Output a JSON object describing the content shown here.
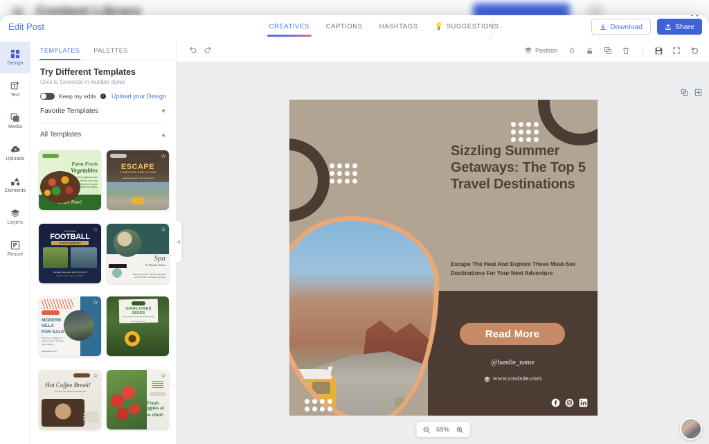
{
  "background_app": {
    "title": "Content Library",
    "menu_icon": "hamburger-icon",
    "primary_button_label": "",
    "avatar": "user-avatar"
  },
  "modal": {
    "close_icon": "close-icon",
    "edit_post_label": "Edit Post",
    "tabs": [
      {
        "label": "CREATIVES",
        "active": true,
        "icon": ""
      },
      {
        "label": "CAPTIONS",
        "active": false,
        "icon": ""
      },
      {
        "label": "HASHTAGS",
        "active": false,
        "icon": ""
      },
      {
        "label": "SUGGESTIONS",
        "active": false,
        "icon": "lightbulb-icon"
      }
    ],
    "actions": {
      "download_label": "Download",
      "download_icon": "download-icon",
      "share_label": "Share",
      "share_icon": "share-icon"
    }
  },
  "rail": {
    "items": [
      {
        "label": "Design",
        "icon": "design-grid-icon",
        "active": true
      },
      {
        "label": "Text",
        "icon": "text-add-icon",
        "active": false
      },
      {
        "label": "Media",
        "icon": "media-image-icon",
        "active": false
      },
      {
        "label": "Uploads",
        "icon": "upload-cloud-icon",
        "active": false
      },
      {
        "label": "Elements",
        "icon": "elements-shapes-icon",
        "active": false
      },
      {
        "label": "Layers",
        "icon": "layers-stack-icon",
        "active": false
      },
      {
        "label": "Resize",
        "icon": "resize-icon",
        "active": false
      }
    ]
  },
  "panel": {
    "tabs": [
      {
        "label": "TEMPLATES",
        "active": true
      },
      {
        "label": "PALETTES",
        "active": false
      }
    ],
    "heading": "Try Different Templates",
    "subheading": "Click to Generate in multiple styles",
    "toggle_label": "Keep my edits",
    "toggle_info_icon": "info-icon",
    "toggle_state": "off",
    "upload_link": "Upload your Design",
    "sections": [
      {
        "label": "Favorite Templates",
        "expanded": false,
        "chevron": "chevron-down-icon"
      },
      {
        "label": "All Templates",
        "expanded": true,
        "chevron": "chevron-up-icon"
      }
    ],
    "collapse_handle_icon": "chevron-left-icon",
    "templates": [
      {
        "name": "Farm Fresh Vegetables",
        "title_line1": "Farm Fresh",
        "title_line2": "Vegetables",
        "cta": "Order Now!",
        "favorited": false
      },
      {
        "name": "Escape Discover New Places",
        "title_line1": "ESCAPE",
        "title_line2": "& DISCOVER NEW PLACES",
        "cta": "",
        "favorited": true
      },
      {
        "name": "Football Tournament",
        "title_line1": "FOOTBALL",
        "title_line2": "TOURNAMENT",
        "cta": "",
        "favorited": true
      },
      {
        "name": "Spa Beauty Salon",
        "title_line1": "Spa",
        "title_line2": "& Beauty Salon",
        "cta": "",
        "favorited": true
      },
      {
        "name": "Modern Villa For Sale",
        "title_line1": "MODERN VILLA",
        "title_line2": "FOR SALE",
        "cta": "",
        "favorited": true
      },
      {
        "name": "Sunflower Seeds",
        "title_line1": "SUNFLOWER",
        "title_line2": "SEEDS",
        "cta": "",
        "favorited": false
      },
      {
        "name": "Hot Coffee Break",
        "title_line1": "Hot Coffee Break!",
        "title_line2": "",
        "cta": "",
        "favorited": true
      },
      {
        "name": "Fresh Veggies at one click",
        "title_line1": "Fresh Veggies at",
        "title_line2": "one click!",
        "cta": "",
        "favorited": true
      }
    ]
  },
  "canvas_toolbar": {
    "undo_icon": "undo-icon",
    "redo_icon": "redo-icon",
    "position_label": "Position",
    "position_icon": "layers-icon",
    "transparency_icon": "droplet-icon",
    "lock_icon": "unlock-icon",
    "duplicate_icon": "duplicate-icon",
    "delete_icon": "trash-icon",
    "save_icon": "save-floppy-icon",
    "fullscreen_icon": "fullscreen-icon",
    "reset_icon": "reset-icon"
  },
  "canvas_page_icons": {
    "duplicate_page_icon": "duplicate-page-icon",
    "add_page_icon": "add-page-icon"
  },
  "zoom_control": {
    "zoom_out_icon": "zoom-out-icon",
    "value": "69%",
    "zoom_in_icon": "zoom-in-icon"
  },
  "poster": {
    "headline": "Sizzling Summer Getaways: The Top 5 Travel Destinations",
    "subline": "Escape The Heat And Explore These Must-See Destinations For Your Next Adventure",
    "cta_label": "Read More",
    "handle": "@handle_name",
    "website": "www.coolsite.com",
    "website_icon": "globe-icon",
    "socials": [
      {
        "name": "facebook-icon"
      },
      {
        "name": "instagram-icon"
      },
      {
        "name": "linkedin-icon"
      }
    ],
    "colors": {
      "background": "#b2a492",
      "dark_brown": "#4d3c34",
      "accent_peach": "#e8a877",
      "cta": "#c78a66",
      "headline_text": "#51413c"
    }
  },
  "user_avatar": "user-avatar"
}
